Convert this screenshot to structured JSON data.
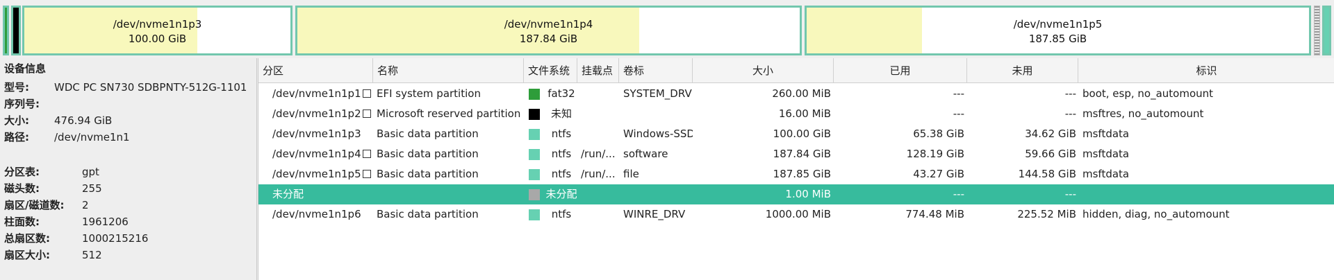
{
  "map": {
    "segments": [
      {
        "name": "/dev/nvme1n1p3",
        "size": "100.00 GiB",
        "used_fraction": 0.65
      },
      {
        "name": "/dev/nvme1n1p4",
        "size": "187.84 GiB",
        "used_fraction": 0.68
      },
      {
        "name": "/dev/nvme1n1p5",
        "size": "187.85 GiB",
        "used_fraction": 0.23
      }
    ]
  },
  "device": {
    "title": "设备信息",
    "model_label": "型号:",
    "model": "WDC PC SN730 SDBPNTY-512G-1101",
    "serial_label": "序列号:",
    "serial": "",
    "size_label": "大小:",
    "size": "476.94 GiB",
    "path_label": "路径:",
    "path": "/dev/nvme1n1",
    "table_label": "分区表:",
    "table": "gpt",
    "heads_label": "磁头数:",
    "heads": "255",
    "spt_label": "扇区/磁道数:",
    "spt": "2",
    "cyl_label": "柱面数:",
    "cyl": "1961206",
    "total_label": "总扇区数:",
    "total": "1000215216",
    "sector_label": "扇区大小:",
    "sector": "512"
  },
  "columns": {
    "partition": "分区",
    "name": "名称",
    "fs": "文件系统",
    "mount": "挂载点",
    "label": "卷标",
    "size": "大小",
    "used": "已用",
    "unused": "未用",
    "flags": "标识"
  },
  "rows": [
    {
      "partition": "/dev/nvme1n1p1",
      "name": "EFI system partition",
      "fs": "fat32",
      "fs_color": "#2e9d3a",
      "mount": "",
      "label": "SYSTEM_DRV",
      "size": "260.00 MiB",
      "used": "---",
      "unused": "---",
      "flags": "boot, esp, no_automount"
    },
    {
      "partition": "/dev/nvme1n1p2",
      "name": "Microsoft reserved partition",
      "fs": "未知",
      "fs_color": "#000000",
      "mount": "",
      "label": "",
      "size": "16.00 MiB",
      "used": "---",
      "unused": "---",
      "flags": "msftres, no_automount"
    },
    {
      "partition": "/dev/nvme1n1p3",
      "name": "Basic data partition",
      "fs": "ntfs",
      "fs_color": "#66d1b2",
      "mount": "",
      "label": "Windows-SSD",
      "size": "100.00 GiB",
      "used": "65.38 GiB",
      "unused": "34.62 GiB",
      "flags": "msftdata"
    },
    {
      "partition": "/dev/nvme1n1p4",
      "name": "Basic data partition",
      "fs": "ntfs",
      "fs_color": "#66d1b2",
      "mount": "/run/...",
      "label": "software",
      "size": "187.84 GiB",
      "used": "128.19 GiB",
      "unused": "59.66 GiB",
      "flags": "msftdata"
    },
    {
      "partition": "/dev/nvme1n1p5",
      "name": "Basic data partition",
      "fs": "ntfs",
      "fs_color": "#66d1b2",
      "mount": "/run/...",
      "label": "file",
      "size": "187.85 GiB",
      "used": "43.27 GiB",
      "unused": "144.58 GiB",
      "flags": "msftdata"
    },
    {
      "partition": "未分配",
      "name": "",
      "fs": "未分配",
      "fs_color": "#a8a8a8",
      "mount": "",
      "label": "",
      "size": "1.00 MiB",
      "used": "---",
      "unused": "---",
      "flags": ""
    },
    {
      "partition": "/dev/nvme1n1p6",
      "name": "Basic data partition",
      "fs": "ntfs",
      "fs_color": "#66d1b2",
      "mount": "",
      "label": "WINRE_DRV",
      "size": "1000.00 MiB",
      "used": "774.48 MiB",
      "unused": "225.52 MiB",
      "flags": "hidden, diag, no_automount"
    }
  ],
  "selected_row": 5,
  "colors": {
    "accent": "#37bb9d",
    "border": "#72c7ad",
    "used": "#f8f8bc"
  }
}
